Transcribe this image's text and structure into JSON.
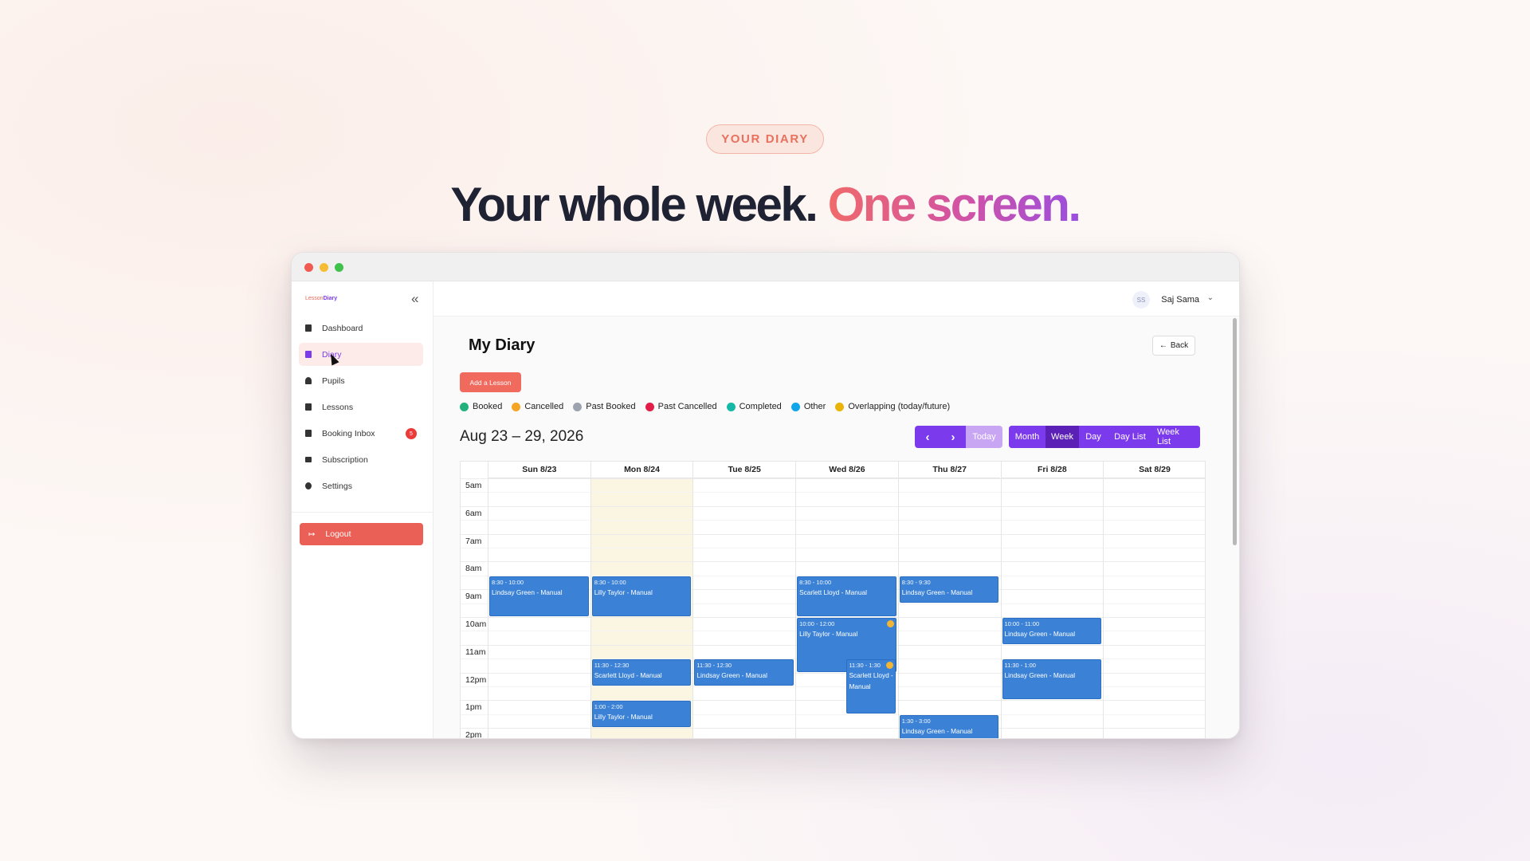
{
  "hero": {
    "eyebrow": "YOUR DIARY",
    "headline_main": "Your whole week.",
    "headline_accent": "One screen."
  },
  "app": {
    "logo_text": "Lesson",
    "logo_accent": "Diary"
  },
  "sidebar": {
    "items": [
      {
        "label": "Dashboard",
        "icon": "bar-chart-icon"
      },
      {
        "label": "Diary",
        "icon": "calendar-icon"
      },
      {
        "label": "Pupils",
        "icon": "user-icon"
      },
      {
        "label": "Lessons",
        "icon": "book-icon"
      },
      {
        "label": "Booking Inbox",
        "icon": "inbox-icon",
        "badge": "5"
      },
      {
        "label": "Subscription",
        "icon": "credit-card-icon"
      },
      {
        "label": "Settings",
        "icon": "gear-icon"
      }
    ],
    "logout_label": "Logout"
  },
  "user": {
    "initials": "SS",
    "name": "Saj Sama"
  },
  "page": {
    "title": "My Diary",
    "back_label": "Back",
    "add_lesson_label": "Add a Lesson",
    "date_range": "Aug 23 – 29, 2026"
  },
  "legend": [
    {
      "label": "Booked",
      "color": "#22b07d"
    },
    {
      "label": "Cancelled",
      "color": "#f5a524"
    },
    {
      "label": "Past Booked",
      "color": "#9ca3af"
    },
    {
      "label": "Past Cancelled",
      "color": "#e11d48"
    },
    {
      "label": "Completed",
      "color": "#14b8a6"
    },
    {
      "label": "Other",
      "color": "#0ea5e9"
    },
    {
      "label": "Overlapping (today/future)",
      "color": "#eab308"
    }
  ],
  "toolbar": {
    "prev_icon": "chevron-left-icon",
    "next_icon": "chevron-right-icon",
    "today_label": "Today",
    "views": [
      "Month",
      "Week",
      "Day",
      "Day List",
      "Week List"
    ],
    "active_view": "Week"
  },
  "calendar": {
    "days": [
      "Sun 8/23",
      "Mon 8/24",
      "Tue 8/25",
      "Wed 8/26",
      "Thu 8/27",
      "Fri 8/28",
      "Sat 8/29"
    ],
    "today_index": 1,
    "hours": [
      "5am",
      "6am",
      "7am",
      "8am",
      "9am",
      "10am",
      "11am",
      "12pm",
      "1pm",
      "2pm"
    ],
    "first_hour": 5,
    "events": [
      {
        "day": 0,
        "start": 8.5,
        "end": 10,
        "time": "8:30 - 10:00",
        "title": "Lindsay Green - Manual"
      },
      {
        "day": 1,
        "start": 8.5,
        "end": 10,
        "time": "8:30 - 10:00",
        "title": "Lilly Taylor - Manual"
      },
      {
        "day": 1,
        "start": 11.5,
        "end": 12.5,
        "time": "11:30 - 12:30",
        "title": "Scarlett Lloyd - Manual"
      },
      {
        "day": 1,
        "start": 13,
        "end": 14,
        "time": "1:00 - 2:00",
        "title": "Lilly Taylor - Manual"
      },
      {
        "day": 2,
        "start": 11.5,
        "end": 12.5,
        "time": "11:30 - 12:30",
        "title": "Lindsay Green - Manual"
      },
      {
        "day": 3,
        "start": 8.5,
        "end": 10,
        "time": "8:30 - 10:00",
        "title": "Scarlett Lloyd - Manual"
      },
      {
        "day": 3,
        "start": 10,
        "end": 12,
        "time": "10:00 - 12:00",
        "title": "Lilly Taylor - Manual",
        "overlap": true
      },
      {
        "day": 3,
        "start": 11.5,
        "end": 13.5,
        "time": "11:30 - 1:30",
        "title": "Scarlett Lloyd - Manual",
        "overlap": true,
        "narrow": true
      },
      {
        "day": 4,
        "start": 8.5,
        "end": 9.5,
        "time": "8:30 - 9:30",
        "title": "Lindsay Green - Manual"
      },
      {
        "day": 4,
        "start": 13.5,
        "end": 15,
        "time": "1:30 - 3:00",
        "title": "Lindsay Green - Manual"
      },
      {
        "day": 5,
        "start": 10,
        "end": 11,
        "time": "10:00 - 11:00",
        "title": "Lindsay Green - Manual"
      },
      {
        "day": 5,
        "start": 11.5,
        "end": 13,
        "time": "11:30 - 1:00",
        "title": "Lindsay Green - Manual"
      }
    ]
  }
}
